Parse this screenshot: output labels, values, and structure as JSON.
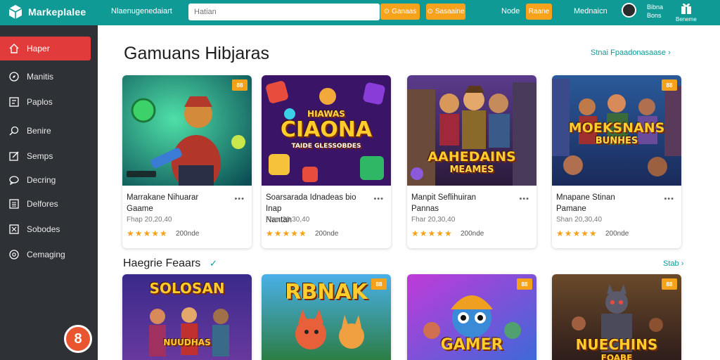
{
  "header": {
    "brand": "Markeplalee",
    "nav_link": "Nlaenugenedaiart",
    "search_placeholder": "Hatian",
    "btn1": "Ganaas",
    "btn2": "Sasaaine",
    "node_link": "Node",
    "node_btn": "Raane",
    "user_link": "Mednaicn",
    "user_small_1": "Bibna",
    "user_small_2": "Bons",
    "gift_label": "Beneme"
  },
  "sidebar": {
    "items": [
      {
        "label": "Haper",
        "icon": "home-icon"
      },
      {
        "label": "Manitis",
        "icon": "compass-icon"
      },
      {
        "label": "Paplos",
        "icon": "grid-icon"
      },
      {
        "label": "Benire",
        "icon": "search-icon"
      },
      {
        "label": "Semps",
        "icon": "edit-icon"
      },
      {
        "label": "Decring",
        "icon": "chat-icon"
      },
      {
        "label": "Delfores",
        "icon": "list-icon"
      },
      {
        "label": "Sobodes",
        "icon": "box-icon"
      },
      {
        "label": "Cemaging",
        "icon": "settings-icon"
      }
    ],
    "chat_label": "8"
  },
  "main": {
    "section_title": "Gamuans Hibjaras",
    "see_all": "Stnai Fpaadonasaase",
    "sub_title": "Haegrie Feaars",
    "sub_more": "Stab",
    "cards": [
      {
        "title1": "Marrakane Nihuarar",
        "title2": "Gaame",
        "meta": "Fhap 20,20,40",
        "count": "200nde",
        "badge": "88",
        "art_text": "",
        "art_sub": ""
      },
      {
        "title1": "Soarsarada Idnadeas bio Inap",
        "title2": "Nantan",
        "meta": "Fhar 20,30,40",
        "count": "200nde",
        "badge": "",
        "art_text": "CIAONA",
        "art_sub": "TAIDE GLESSOBDES",
        "art_top": "HIAWAS"
      },
      {
        "title1": "Manpit Seflihuiran",
        "title2": "Pannas",
        "meta": "Fhar 20,30,40",
        "count": "200nde",
        "badge": "",
        "art_text": "AAHEDAINS",
        "art_sub": "MEAMES"
      },
      {
        "title1": "Mnapane Stinan",
        "title2": "Pamane",
        "meta": "Shan 20,30,40",
        "count": "200nde",
        "badge": "88",
        "art_text": "MOEKSNANS",
        "art_sub": "BUNHES"
      }
    ],
    "bottom_cards": [
      {
        "art_text": "SOLOSAN",
        "art_sub": "NUUDHAS",
        "badge": ""
      },
      {
        "art_text": "RBNAK",
        "badge": "88"
      },
      {
        "art_text": "GAMER",
        "badge": "88"
      },
      {
        "art_text": "NUECHINS",
        "art_sub": "FOABE",
        "badge": "88"
      }
    ],
    "stars": "★★★★★"
  },
  "colors": {
    "topbar": "#0f9a95",
    "accent_orange": "#f7a21b",
    "sidebar_bg": "#2e3135",
    "active_red": "#e23b3b"
  }
}
